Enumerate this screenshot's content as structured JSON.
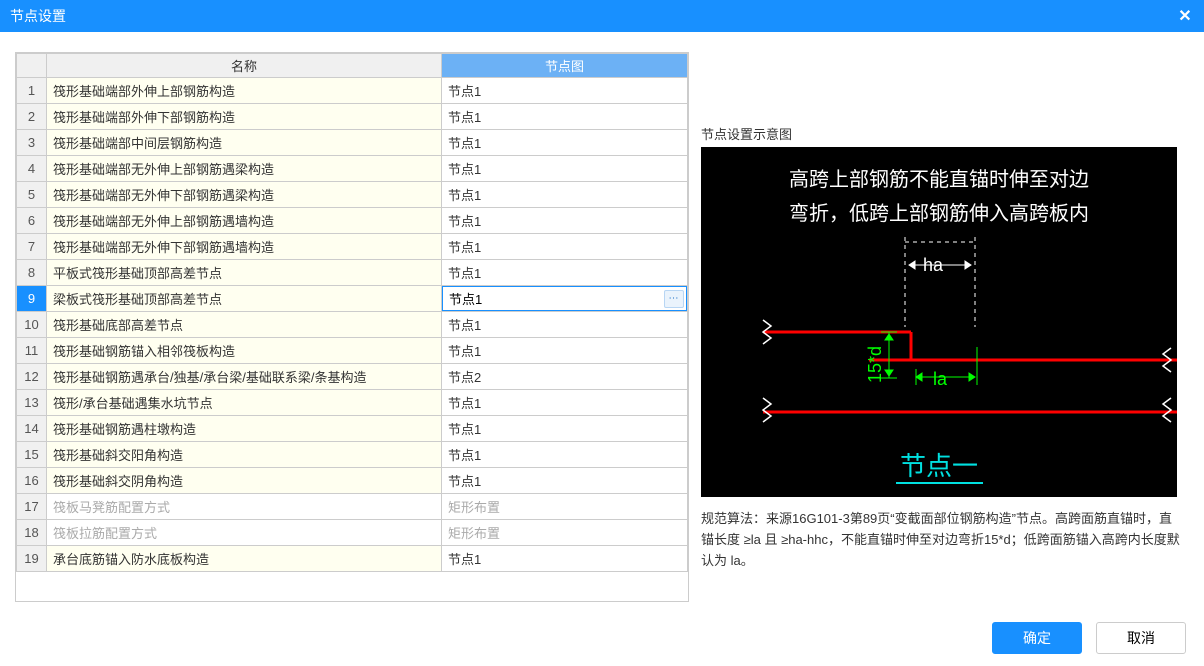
{
  "window": {
    "title": "节点设置"
  },
  "table": {
    "headers": {
      "name": "名称",
      "node": "节点图"
    },
    "rows": [
      {
        "idx": "1",
        "name": "筏形基础端部外伸上部钢筋构造",
        "node": "节点1",
        "disabled": false
      },
      {
        "idx": "2",
        "name": "筏形基础端部外伸下部钢筋构造",
        "node": "节点1",
        "disabled": false
      },
      {
        "idx": "3",
        "name": "筏形基础端部中间层钢筋构造",
        "node": "节点1",
        "disabled": false
      },
      {
        "idx": "4",
        "name": "筏形基础端部无外伸上部钢筋遇梁构造",
        "node": "节点1",
        "disabled": false
      },
      {
        "idx": "5",
        "name": "筏形基础端部无外伸下部钢筋遇梁构造",
        "node": "节点1",
        "disabled": false
      },
      {
        "idx": "6",
        "name": "筏形基础端部无外伸上部钢筋遇墙构造",
        "node": "节点1",
        "disabled": false
      },
      {
        "idx": "7",
        "name": "筏形基础端部无外伸下部钢筋遇墙构造",
        "node": "节点1",
        "disabled": false
      },
      {
        "idx": "8",
        "name": "平板式筏形基础顶部高差节点",
        "node": "节点1",
        "disabled": false
      },
      {
        "idx": "9",
        "name": "梁板式筏形基础顶部高差节点",
        "node": "节点1",
        "disabled": false,
        "selected": true,
        "editing": true
      },
      {
        "idx": "10",
        "name": "筏形基础底部高差节点",
        "node": "节点1",
        "disabled": false
      },
      {
        "idx": "11",
        "name": "筏形基础钢筋锚入相邻筏板构造",
        "node": "节点1",
        "disabled": false
      },
      {
        "idx": "12",
        "name": "筏形基础钢筋遇承台/独基/承台梁/基础联系梁/条基构造",
        "node": "节点2",
        "disabled": false
      },
      {
        "idx": "13",
        "name": "筏形/承台基础遇集水坑节点",
        "node": "节点1",
        "disabled": false
      },
      {
        "idx": "14",
        "name": "筏形基础钢筋遇柱墩构造",
        "node": "节点1",
        "disabled": false
      },
      {
        "idx": "15",
        "name": "筏形基础斜交阳角构造",
        "node": "节点1",
        "disabled": false
      },
      {
        "idx": "16",
        "name": "筏形基础斜交阴角构造",
        "node": "节点1",
        "disabled": false
      },
      {
        "idx": "17",
        "name": "筏板马凳筋配置方式",
        "node": "矩形布置",
        "disabled": true
      },
      {
        "idx": "18",
        "name": "筏板拉筋配置方式",
        "node": "矩形布置",
        "disabled": true
      },
      {
        "idx": "19",
        "name": "承台底筋锚入防水底板构造",
        "node": "节点1",
        "disabled": false
      }
    ]
  },
  "preview": {
    "title": "节点设置示意图",
    "line1": "高跨上部钢筋不能直锚时伸至对边",
    "line2": "弯折，低跨上部钢筋伸入高跨板内",
    "ha_label": "ha",
    "dim_label": "15*d",
    "la_label": "la",
    "caption": "节点一",
    "spec": "规范算法：来源16G101-3第89页“变截面部位钢筋构造”节点。高跨面筋直锚时，直锚长度 ≥la 且 ≥ha-hhc，不能直锚时伸至对边弯折15*d；低跨面筋锚入高跨内长度默认为 la。"
  },
  "buttons": {
    "ok": "确定",
    "cancel": "取消"
  }
}
